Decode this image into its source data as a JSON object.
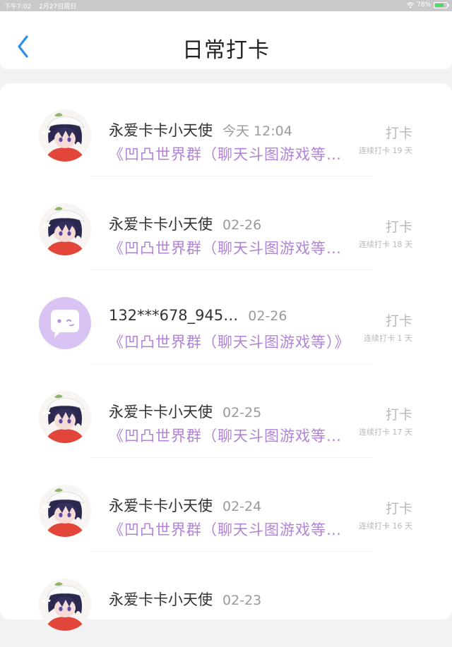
{
  "status_bar": {
    "time": "下午7:02",
    "date": "2月27日周日",
    "battery": "78%",
    "battery_level": 0.78
  },
  "header": {
    "title": "日常打卡",
    "back_icon": "chevron-left-icon",
    "accent_color": "#2f8fe8"
  },
  "list": {
    "items": [
      {
        "username": "永爱卡卡小天使",
        "time": "今天 12:04",
        "group": "《凹凸世界群（聊天斗图游戏等…",
        "action": "打卡",
        "streak": "连续打卡 19 天",
        "avatar": "anime-avatar"
      },
      {
        "username": "永爱卡卡小天使",
        "time": "02-26",
        "group": "《凹凸世界群（聊天斗图游戏等…",
        "action": "打卡",
        "streak": "连续打卡 18 天",
        "avatar": "anime-avatar"
      },
      {
        "username": "132***678_945…",
        "time": "02-26",
        "group": "《凹凸世界群（聊天斗图游戏等）》",
        "action": "打卡",
        "streak": "连续打卡 1 天",
        "avatar": "default-chat-avatar"
      },
      {
        "username": "永爱卡卡小天使",
        "time": "02-25",
        "group": "《凹凸世界群（聊天斗图游戏等…",
        "action": "打卡",
        "streak": "连续打卡 17 天",
        "avatar": "anime-avatar"
      },
      {
        "username": "永爱卡卡小天使",
        "time": "02-24",
        "group": "《凹凸世界群（聊天斗图游戏等…",
        "action": "打卡",
        "streak": "连续打卡 16 天",
        "avatar": "anime-avatar"
      },
      {
        "username": "永爱卡卡小天使",
        "time": "02-23",
        "group": "",
        "action": "",
        "streak": "",
        "avatar": "anime-avatar"
      }
    ]
  },
  "colors": {
    "group_text": "#b083d7",
    "default_avatar_bg": "#d9c3f3",
    "muted_text": "#b8b8b8"
  }
}
